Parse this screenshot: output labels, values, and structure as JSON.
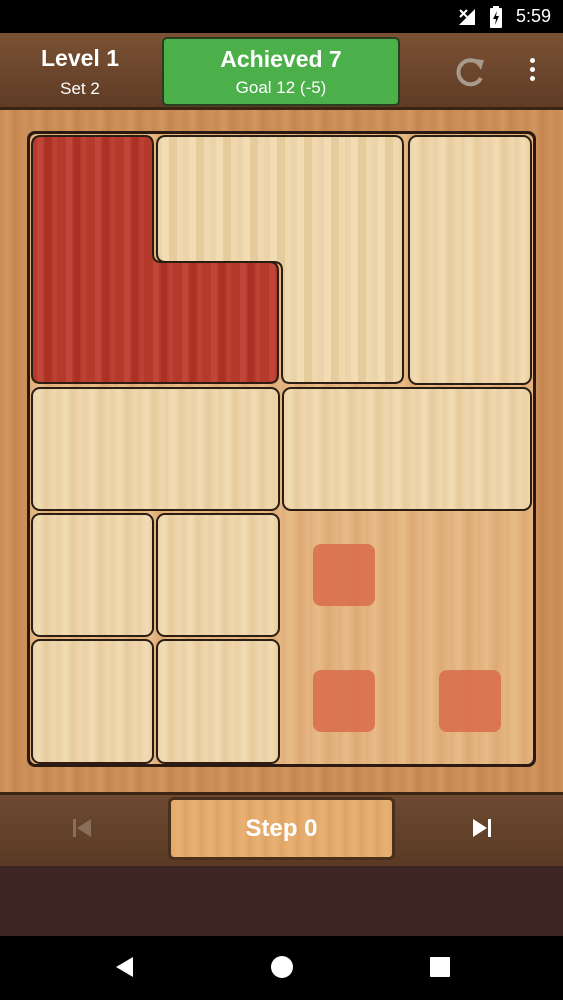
{
  "status_bar": {
    "time": "5:59",
    "icons": [
      "signal-off-icon",
      "battery-charging-icon"
    ]
  },
  "header": {
    "level": "Level 1",
    "set": "Set 2",
    "achieved": "Achieved 7",
    "goal": "Goal 12 (-5)",
    "icons": [
      "restart-icon",
      "more-vert-icon"
    ],
    "colors": {
      "achieved_bg": "#4bb04a",
      "header_bg": "#6b4430"
    }
  },
  "board": {
    "pieces": [
      "red L-shaped target block",
      "light wood L-shaped block",
      "light wood tall block",
      "light wood wide block",
      "light wood wide block",
      "light wood small block",
      "light wood small block",
      "light wood small block",
      "light wood small block"
    ],
    "target_markers": 3,
    "colors": {
      "red_piece": "#b63a2c",
      "wood_piece": "#ecd4aa",
      "target": "#d96b4b"
    }
  },
  "controls": {
    "step_label": "Step 0",
    "icons": [
      "skip-previous-icon",
      "skip-next-icon"
    ]
  },
  "nav_bar": {
    "icons": [
      "back-icon",
      "home-icon",
      "recents-icon"
    ]
  }
}
